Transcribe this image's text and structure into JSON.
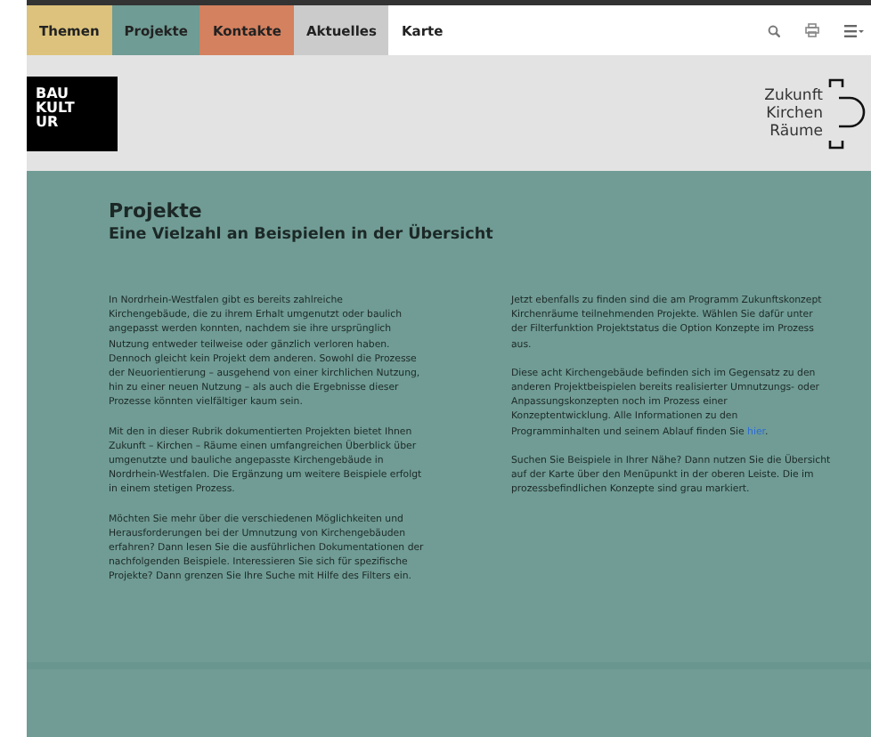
{
  "nav": {
    "tabs": [
      {
        "label": "Themen",
        "color": "#dcc27c"
      },
      {
        "label": "Projekte",
        "color": "#6f9c94"
      },
      {
        "label": "Kontakte",
        "color": "#d4815f"
      },
      {
        "label": "Aktuelles",
        "color": "#cbcbcb"
      },
      {
        "label": "Karte",
        "color": "#ffffff"
      }
    ]
  },
  "header": {
    "logo_left": [
      "BAU",
      "KULT",
      "UR"
    ],
    "logo_right": [
      "Zukunft",
      "Kirchen",
      "Räume"
    ]
  },
  "content": {
    "title": "Projekte",
    "subtitle": "Eine Vielzahl an Beispielen in der Übersicht",
    "columns": [
      [
        {
          "text": "In Nordrhein-Westfalen gibt es bereits zahlreiche\nKirchengebäude, die zu ihrem Erhalt umgenutzt oder baulich\nangepasst werden konnten, nachdem sie ihre ursprünglich\nNutzung entweder teilweise oder gänzlich verloren haben.\nDennoch gleicht kein Projekt dem anderen. Sowohl die Prozesse\nder Neuorientierung  – ausgehend von einer kirchlichen Nutzung,\nhin zu einer neuen Nutzung – als auch die Ergebnisse dieser\nProzesse könnten vielfältiger kaum sein."
        },
        {
          "text": "Mit den in dieser Rubrik dokumentierten Projekten bietet Ihnen\nZukunft – Kirchen – Räume einen umfangreichen Überblick über\numgenutzte und bauliche angepasste Kirchengebäude in\nNordrhein-Westfalen. Die Ergänzung um weitere Beispiele erfolgt\nin einem stetigen Prozess."
        },
        {
          "text": "Möchten Sie mehr über die verschiedenen Möglichkeiten und\nHerausforderungen bei der Umnutzung von Kirchengebäuden\nerfahren? Dann lesen Sie die ausführlichen Dokumentationen der\nnachfolgenden Beispiele. Interessieren Sie sich für spezifische\nProjekte? Dann grenzen Sie Ihre Suche mit Hilfe des Filters ein."
        }
      ],
      [
        {
          "text": "Jetzt ebenfalls zu finden sind die am Programm Zukunftskonzept\nKirchenräume teilnehmenden Projekte. Wählen Sie dafür unter\nder Filterfunktion Projektstatus  die Option Konzepte im Prozess\naus."
        },
        {
          "text": "Diese acht Kirchengebäude befinden sich im Gegensatz zu den\nanderen Projektbeispielen bereits realisierter Umnutzungs- oder\nAnpassungskonzepten noch im Prozess einer\nKonzeptentwicklung. Alle Informationen zu den\nProgramminhalten und seinem Ablauf finden Sie ",
          "link": "hier",
          "after": "."
        },
        {
          "text": "Suchen Sie Beispiele in Ihrer Nähe? Dann nutzen Sie die Übersicht\nauf der Karte über den Menüpunkt in der oberen Leiste. Die im\nprozessbefindlichen Konzepte sind grau markiert."
        }
      ]
    ]
  }
}
